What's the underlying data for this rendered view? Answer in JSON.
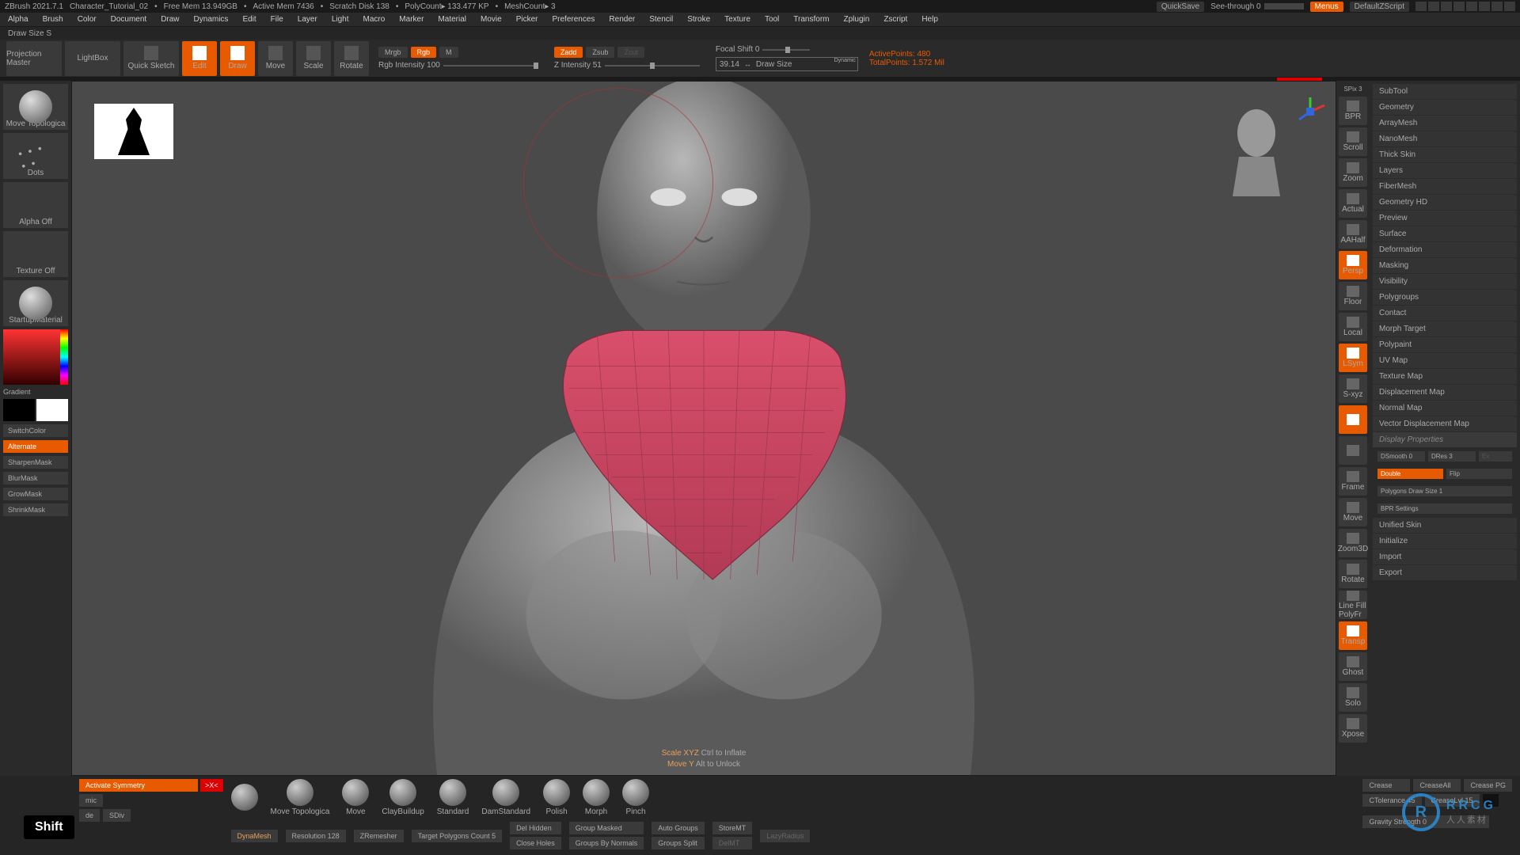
{
  "title": {
    "app": "ZBrush 2021.7.1",
    "doc": "Character_Tutorial_02",
    "freemem": "Free Mem 13.949GB",
    "activemem": "Active Mem 7436",
    "scratch": "Scratch Disk 138",
    "polycount": "PolyCount▸ 133.477 KP",
    "meshcount": "MeshCount▸ 3",
    "quicksave": "QuickSave",
    "seethrough": "See-through  0",
    "menus": "Menus",
    "zscript": "DefaultZScript"
  },
  "menu": [
    "Alpha",
    "Brush",
    "Color",
    "Document",
    "Draw",
    "Dynamics",
    "Edit",
    "File",
    "Layer",
    "Light",
    "Macro",
    "Marker",
    "Material",
    "Movie",
    "Picker",
    "Preferences",
    "Render",
    "Stencil",
    "Stroke",
    "Texture",
    "Tool",
    "Transform",
    "Zplugin",
    "Zscript",
    "Help"
  ],
  "status": "Draw Size S",
  "toolbar": {
    "proj_master": "Projection Master",
    "lightbox": "LightBox",
    "quicksketch": "Quick Sketch",
    "edit": "Edit",
    "draw": "Draw",
    "move": "Move",
    "scale": "Scale",
    "rotate": "Rotate",
    "mrgb": "Mrgb",
    "rgb": "Rgb",
    "m": "M",
    "rgb_intensity": "Rgb Intensity 100",
    "zadd": "Zadd",
    "zsub": "Zsub",
    "zcut": "Zcut",
    "z_intensity": "Z Intensity 51",
    "focal": "Focal Shift 0",
    "drawsize_val": "39.14",
    "drawsize_lbl": "Draw Size",
    "dynamic": "Dynamic",
    "active_pts": "ActivePoints: 480",
    "total_pts": "TotalPoints: 1.572 Mil"
  },
  "left": {
    "brush": "Move Topologica",
    "stroke": "Dots",
    "alpha": "Alpha Off",
    "texture": "Texture Off",
    "material": "StartupMaterial",
    "gradient": "Gradient",
    "switchcolor": "SwitchColor",
    "alternate": "Alternate",
    "sharpen": "SharpenMask",
    "blur": "BlurMask",
    "grow": "GrowMask",
    "shrink": "ShrinkMask"
  },
  "viewport": {
    "hint1a": "Scale XYZ ",
    "hint1b": "Ctrl to Inflate",
    "hint2a": "Move Y ",
    "hint2b": "Alt to Unlock"
  },
  "right_tools": {
    "spix": "SPix 3",
    "items": [
      "BPR",
      "Scroll",
      "Zoom",
      "Actual",
      "AAHalf",
      "Persp",
      "Floor",
      "Local",
      "LSym",
      "S-xyz",
      "",
      "",
      "Frame",
      "Move",
      "Zoom3D",
      "Rotate",
      "Line Fill PolyFr",
      "Transp",
      "Ghost",
      "Solo",
      "Xpose"
    ]
  },
  "right_panel": {
    "sections": [
      "SubTool",
      "Geometry",
      "ArrayMesh",
      "NanoMesh",
      "Thick Skin",
      "Layers",
      "FiberMesh",
      "Geometry HD",
      "Preview",
      "Surface",
      "Deformation",
      "Masking",
      "Visibility",
      "Polygroups",
      "Contact",
      "Morph Target",
      "Polypaint",
      "UV Map",
      "Texture Map",
      "Displacement Map",
      "Normal Map",
      "Vector Displacement Map"
    ],
    "display_props": "Display Properties",
    "dsmooth": "DSmooth 0",
    "dres": "DRes 3",
    "ex": "Ex",
    "double": "Double",
    "flip": "Flip",
    "polydraw": "Polygons Draw Size 1",
    "bpr": "BPR Settings",
    "tail": [
      "Unified Skin",
      "Initialize",
      "Import",
      "Export"
    ]
  },
  "bottom": {
    "key": "Shift",
    "activate_sym": "Activate Symmetry",
    "sym_x": ">X<",
    "dynamic": "mic",
    "de": "de",
    "sdiv": "SDiv",
    "dynamesh": "DynaMesh",
    "resolution": "Resolution 128",
    "zremesher": "ZRemesher",
    "target_poly": "Target Polygons Count 5",
    "brushes": [
      "",
      "Move Topologica",
      "Move",
      "ClayBuildup",
      "Standard",
      "DamStandard",
      "Polish",
      "Morph",
      "Pinch"
    ],
    "del_hidden": "Del Hidden",
    "close_holes": "Close Holes",
    "group_masked": "Group Masked",
    "groups_normals": "Groups By Normals",
    "auto_groups": "Auto Groups",
    "groups_split": "Groups Split",
    "storemt": "StoreMT",
    "delmt": "DelMT",
    "lazyradius": "LazyRadius",
    "crease": "Crease",
    "crease_all": "CreaseAll",
    "crease_pg": "Crease PG",
    "ctol": "CTolerance 45",
    "clvl": "CreaseLvl 15",
    "gravity": "Gravity Strength 0"
  },
  "watermark": {
    "brand": "RRCG",
    "sub": "人人素材"
  }
}
